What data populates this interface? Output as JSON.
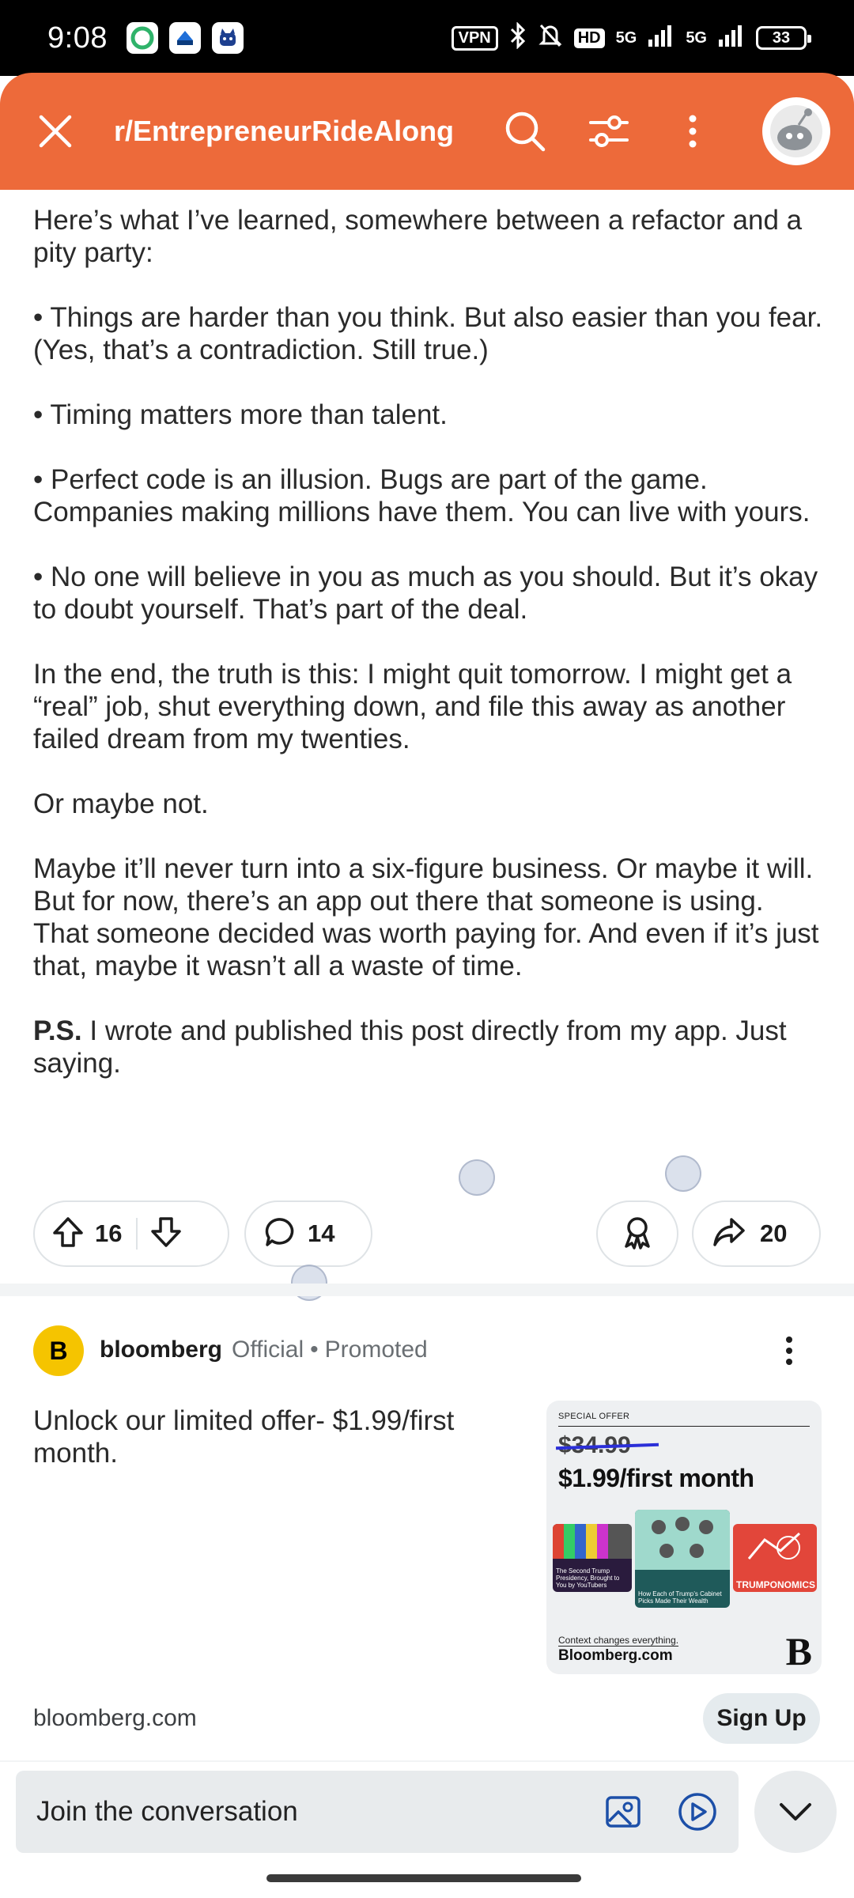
{
  "status_bar": {
    "time": "9:08",
    "vpn": "VPN",
    "hd": "HD",
    "signal_1": "5G",
    "signal_2": "5G",
    "battery": "33",
    "app_icons": [
      "green-app-icon",
      "blue-app-icon",
      "cat-app-icon"
    ]
  },
  "header": {
    "subreddit": "r/EntrepreneurRideAlong",
    "accent_color": "#ed6a3a"
  },
  "post": {
    "paragraphs": [
      "Here’s what I’ve learned, somewhere between a refactor and a pity party:",
      "• Things are harder than you think. But also easier than you fear. (Yes, that’s a contradiction. Still true.)",
      "• Timing matters more than talent.",
      "• Perfect code is an illusion. Bugs are part of the game. Companies making millions have them. You can live with yours.",
      "• No one will believe in you as much as you should. But it’s okay to doubt yourself. That’s part of the deal.",
      "In the end, the truth is this: I might quit tomorrow. I might get a “real” job, shut everything down, and file this away as another failed dream from my twenties.",
      "Or maybe not.",
      "Maybe it’ll never turn into a six-figure business. Or maybe it will. But for now, there’s an app out there that someone is using. That someone decided was worth paying for. And even if it’s just that, maybe it wasn’t all a waste of time."
    ],
    "ps_label": "P.S.",
    "ps_text": " I wrote and published this post directly from my app. Just saying.",
    "actions": {
      "upvotes": "16",
      "comments": "14",
      "shares": "20"
    }
  },
  "promoted": {
    "avatar_letter": "B",
    "author": "bloomberg",
    "official": "Official",
    "separator": "•",
    "promoted_label": "Promoted",
    "headline": "Unlock our limited offer- $1.99/first month.",
    "domain": "bloomberg.com",
    "cta": "Sign Up",
    "image": {
      "special_offer": "SPECIAL OFFER",
      "old_price": "$34.99",
      "new_price": "$1.99/first month",
      "card_left_caption": "The Second Trump Presidency, Brought to You by YouTubers",
      "card_center_caption": "How Each of Trump’s Cabinet Picks Made Their Wealth",
      "card_right_caption": "TRUMPONOMICS",
      "tagline": "Context changes everything.",
      "site": "Bloomberg.com",
      "logo_letter": "B"
    }
  },
  "composer": {
    "placeholder": "Join the conversation"
  }
}
